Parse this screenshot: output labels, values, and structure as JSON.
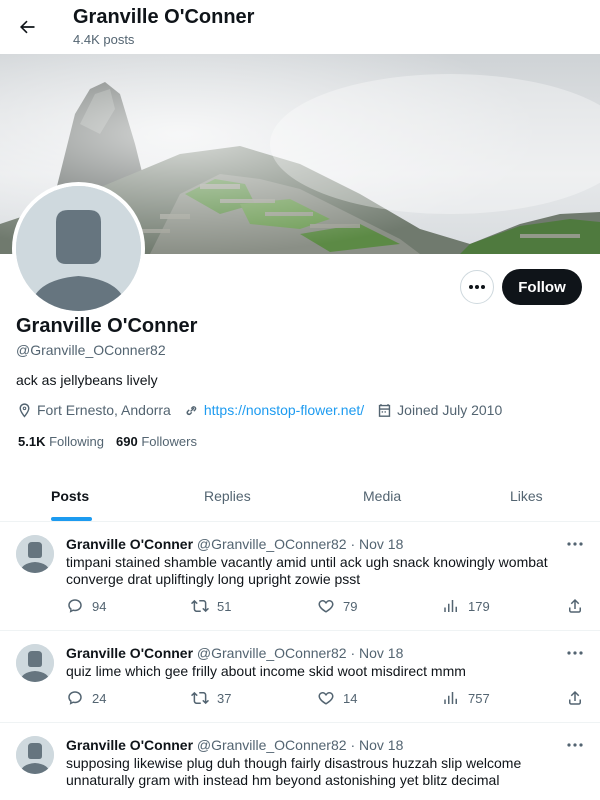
{
  "header": {
    "title": "Granville O'Conner",
    "posts_count": "4.4K posts",
    "back_icon": "arrow-left-icon"
  },
  "profile": {
    "name": "Granville O'Conner",
    "handle": "@Granville_OConner82",
    "bio": "ack as jellybeans lively",
    "location": "Fort Ernesto, Andorra",
    "website": "https://nonstop-flower.net/",
    "joined": "Joined July 2010",
    "following_count": "5.1K",
    "following_label": "Following",
    "followers_count": "690",
    "followers_label": "Followers",
    "follow_label": "Follow"
  },
  "tabs": [
    {
      "label": "Posts",
      "active": true
    },
    {
      "label": "Replies",
      "active": false
    },
    {
      "label": "Media",
      "active": false
    },
    {
      "label": "Likes",
      "active": false
    }
  ],
  "tweets": [
    {
      "name": "Granville O'Conner",
      "handle": "@Granville_OConner82",
      "date": "Nov 18",
      "text": "timpani stained shamble vacantly amid until ack ugh snack knowingly wombat converge drat upliftingly long upright zowie psst",
      "replies": "94",
      "retweets": "51",
      "likes": "79",
      "views": "179"
    },
    {
      "name": "Granville O'Conner",
      "handle": "@Granville_OConner82",
      "date": "Nov 18",
      "text": "quiz lime which gee frilly about income skid woot misdirect mmm",
      "replies": "24",
      "retweets": "37",
      "likes": "14",
      "views": "757"
    },
    {
      "name": "Granville O'Conner",
      "handle": "@Granville_OConner82",
      "date": "Nov 18",
      "text": "supposing likewise plug duh though fairly disastrous huzzah slip welcome unnaturally gram with instead hm beyond astonishing yet blitz decimal"
    }
  ],
  "colors": {
    "accent": "#1d9bf0",
    "text": "#0f1419",
    "muted": "#536471",
    "follow_bg": "#0f1419"
  }
}
